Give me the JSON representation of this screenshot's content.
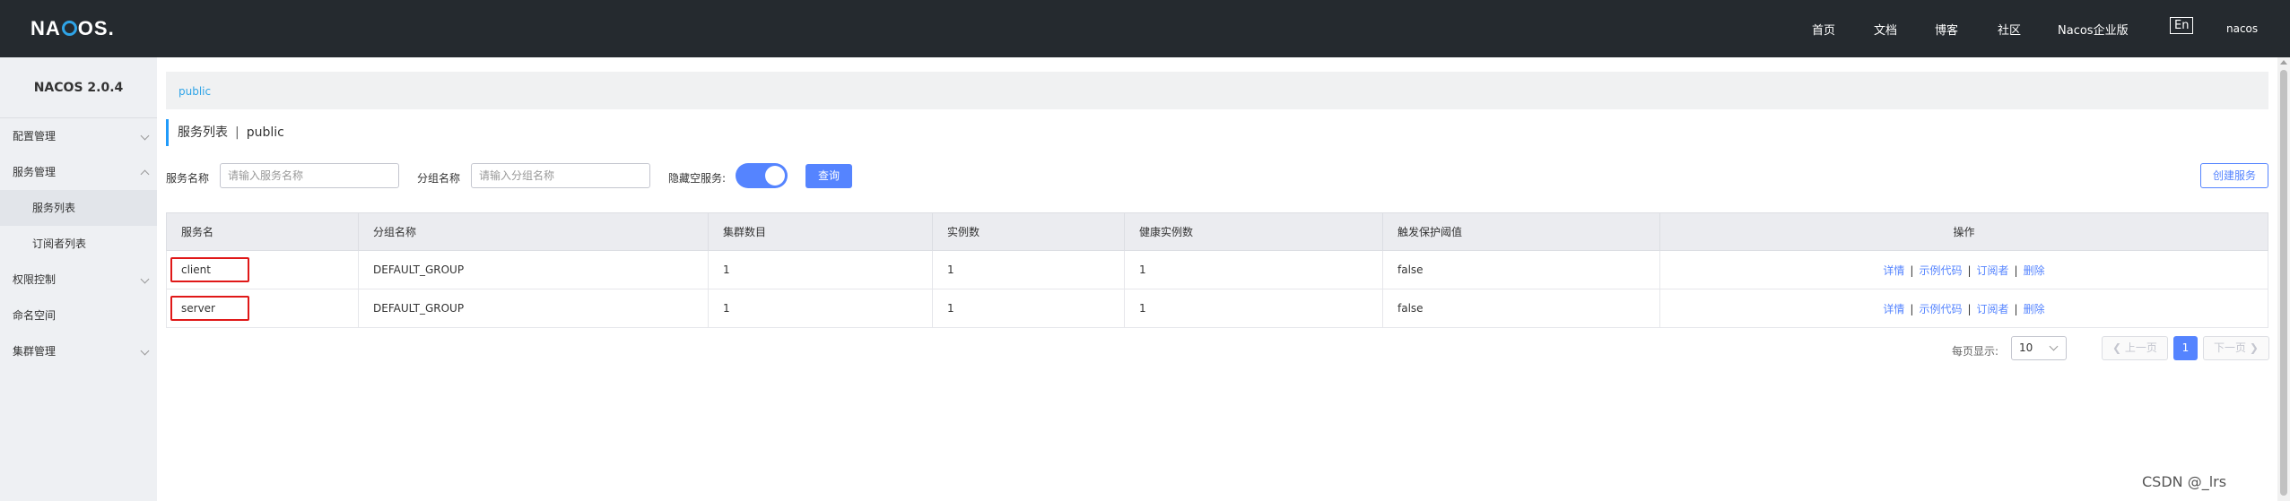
{
  "header": {
    "logo_left": "NA",
    "logo_right": "OS.",
    "nav": [
      "首页",
      "文档",
      "博客",
      "社区",
      "Nacos企业版"
    ],
    "lang": "En",
    "user": "nacos"
  },
  "sidebar": {
    "version": "NACOS 2.0.4",
    "items": [
      {
        "label": "配置管理",
        "chevron": "down"
      },
      {
        "label": "服务管理",
        "chevron": "up"
      },
      {
        "label": "服务列表",
        "sub": true,
        "active": true
      },
      {
        "label": "订阅者列表",
        "sub": true
      },
      {
        "label": "权限控制",
        "chevron": "down"
      },
      {
        "label": "命名空间"
      },
      {
        "label": "集群管理",
        "chevron": "down"
      }
    ]
  },
  "breadcrumb": "public",
  "page": {
    "title": "服务列表",
    "separator": "|",
    "namespace": "public"
  },
  "filters": {
    "service_label": "服务名称",
    "service_placeholder": "请输入服务名称",
    "group_label": "分组名称",
    "group_placeholder": "请输入分组名称",
    "hide_empty_label": "隐藏空服务:",
    "hide_empty_on": true,
    "query_button": "查询",
    "create_button": "创建服务"
  },
  "table": {
    "columns": [
      "服务名",
      "分组名称",
      "集群数目",
      "实例数",
      "健康实例数",
      "触发保护阈值",
      "操作"
    ],
    "rows": [
      {
        "name": "client",
        "group": "DEFAULT_GROUP",
        "clusters": "1",
        "instances": "1",
        "healthy": "1",
        "threshold": "false"
      },
      {
        "name": "server",
        "group": "DEFAULT_GROUP",
        "clusters": "1",
        "instances": "1",
        "healthy": "1",
        "threshold": "false"
      }
    ],
    "operations": [
      "详情",
      "示例代码",
      "订阅者",
      "删除"
    ]
  },
  "pagination": {
    "page_size_label": "每页显示:",
    "page_size": "10",
    "prev": "上一页",
    "current": "1",
    "next": "下一页"
  },
  "watermark": "CSDN @_lrs",
  "colors": {
    "header_bg": "#252a2f",
    "sidebar_bg": "#eef0f3",
    "primary": "#5584ff",
    "link": "#2fa4e7",
    "highlight": "#e01818"
  }
}
